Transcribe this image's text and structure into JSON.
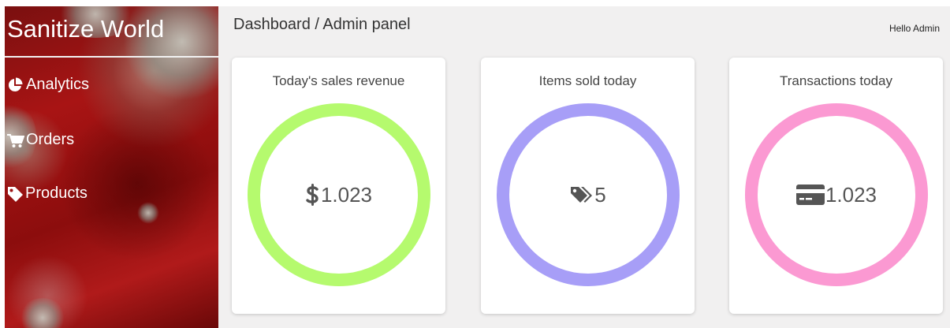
{
  "sidebar": {
    "brand": "Sanitize World",
    "items": [
      {
        "label": "Analytics",
        "icon": "pie-chart-icon"
      },
      {
        "label": "Orders",
        "icon": "shopping-cart-icon"
      },
      {
        "label": "Products",
        "icon": "tag-icon"
      }
    ]
  },
  "header": {
    "title": "Dashboard / Admin panel",
    "greeting": "Hello Admin"
  },
  "cards": [
    {
      "title": "Today's sales revenue",
      "value": "1.023",
      "icon": "dollar-icon",
      "ring_color": "#b5fa6e"
    },
    {
      "title": "Items sold today",
      "value": "5",
      "icon": "tags-icon",
      "ring_color": "#a79ef7"
    },
    {
      "title": "Transactions today",
      "value": "1.023",
      "icon": "credit-card-icon",
      "ring_color": "#fb99d2"
    }
  ]
}
